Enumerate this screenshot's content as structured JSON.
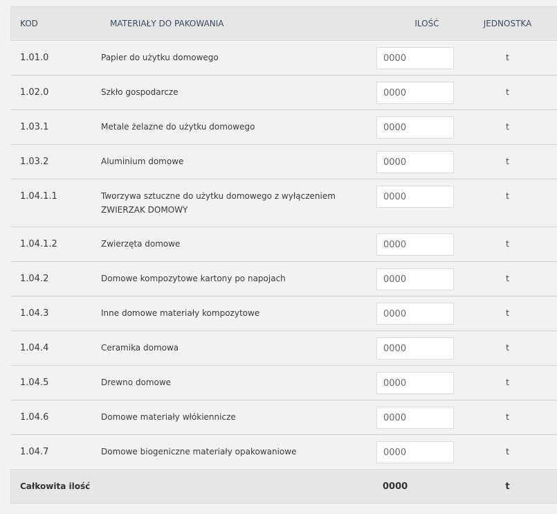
{
  "table": {
    "headers": {
      "code": "KOD",
      "name": "MATERIAŁY DO PAKOWANIA",
      "quantity": "ILOŚĆ",
      "unit": "JEDNOSTKA"
    },
    "rows": [
      {
        "code": "1.01.0",
        "name": "Papier do użytku domowego",
        "placeholder": "0000",
        "unit": "t"
      },
      {
        "code": "1.02.0",
        "name": "Szkło gospodarcze",
        "placeholder": "0000",
        "unit": "t"
      },
      {
        "code": "1.03.1",
        "name": "Metale żelazne do użytku domowego",
        "placeholder": "0000",
        "unit": "t"
      },
      {
        "code": "1.03.2",
        "name": "Aluminium domowe",
        "placeholder": "0000",
        "unit": "t"
      },
      {
        "code": "1.04.1.1",
        "name": "Tworzywa sztuczne do użytku domowego z wyłączeniem ZWIERZAK DOMOWY",
        "placeholder": "0000",
        "unit": "t"
      },
      {
        "code": "1.04.1.2",
        "name": "Zwierzęta domowe",
        "placeholder": "0000",
        "unit": "t"
      },
      {
        "code": "1.04.2",
        "name": "Domowe kompozytowe kartony po napojach",
        "placeholder": "0000",
        "unit": "t"
      },
      {
        "code": "1.04.3",
        "name": "Inne domowe materiały kompozytowe",
        "placeholder": "0000",
        "unit": "t"
      },
      {
        "code": "1.04.4",
        "name": "Ceramika domowa",
        "placeholder": "0000",
        "unit": "t"
      },
      {
        "code": "1.04.5",
        "name": "Drewno domowe",
        "placeholder": "0000",
        "unit": "t"
      },
      {
        "code": "1.04.6",
        "name": "Domowe materiały włókiennicze",
        "placeholder": "0000",
        "unit": "t"
      },
      {
        "code": "1.04.7",
        "name": "Domowe biogeniczne materiały opakowaniowe",
        "placeholder": "0000",
        "unit": "t"
      }
    ],
    "footer": {
      "label": "Całkowita ilość",
      "total": "0000",
      "unit": "t"
    }
  }
}
